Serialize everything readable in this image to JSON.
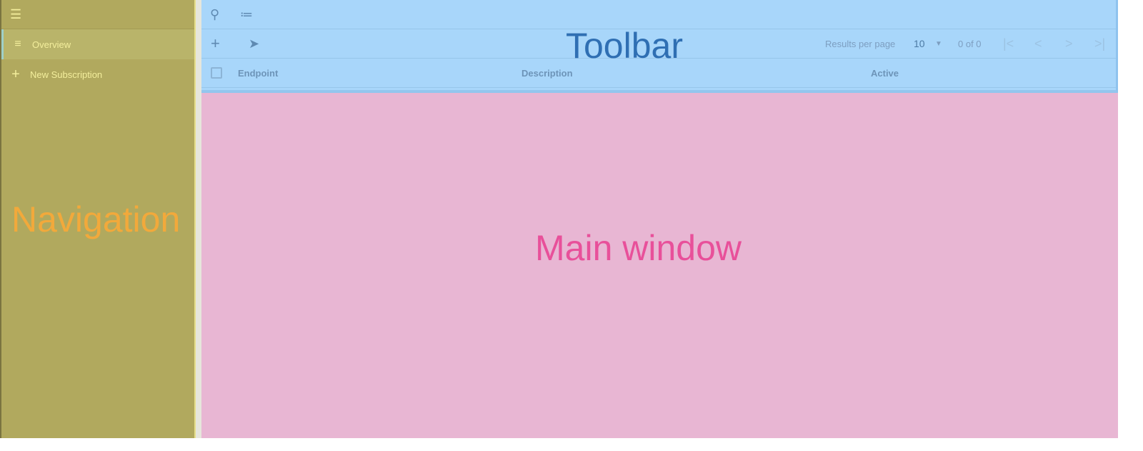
{
  "nav": {
    "menu_icon": "hamburger-icon",
    "items": [
      {
        "label": "Overview",
        "icon": "list-search-icon",
        "selected": true
      },
      {
        "label": "New Subscription",
        "icon": "plus-icon"
      }
    ],
    "region_label": "Navigation"
  },
  "toolbar": {
    "region_label": "Toolbar",
    "search_icon": "search-icon",
    "filter_icon": "tune-icon",
    "add_icon": "plus-icon",
    "send_icon": "send-icon",
    "results_per_page_label": "Results per page",
    "results_per_page_value": "10",
    "range": "0 of 0"
  },
  "table": {
    "columns": [
      "Endpoint",
      "Description",
      "Active"
    ]
  },
  "main": {
    "region_label": "Main window"
  },
  "colors": {
    "navigation": "#b1a95e",
    "toolbar": "#a8d6fa",
    "main": "#e8b6d3",
    "nav_label": "#f2a93b",
    "toolbar_label": "#2f6fb3",
    "main_label": "#e8509a"
  }
}
